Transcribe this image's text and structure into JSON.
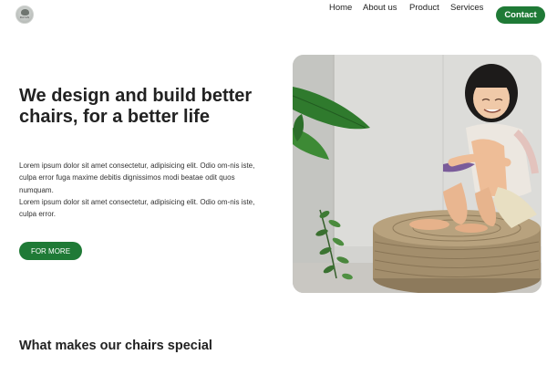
{
  "header": {
    "logo_text": "RAYAN",
    "nav": [
      "Home",
      "About us",
      "Product",
      "Services"
    ],
    "contact_label": "Contact"
  },
  "hero": {
    "title": "We design and build better chairs, for a better life",
    "paragraph_1": "Lorem ipsum dolor sit amet consectetur, adipisicing elit. Odio om-nis iste, culpa error fuga maxime debitis dignissimos modi beatae odit quos numquam.",
    "paragraph_2": "Lorem ipsum dolor sit amet consectetur, adipisicing elit. Odio om-nis iste, culpa error.",
    "button_label": "FOR MORE"
  },
  "features": {
    "title": "What makes our chairs special"
  },
  "colors": {
    "accent": "#1f7a36",
    "text": "#222222",
    "background": "#ffffff"
  }
}
